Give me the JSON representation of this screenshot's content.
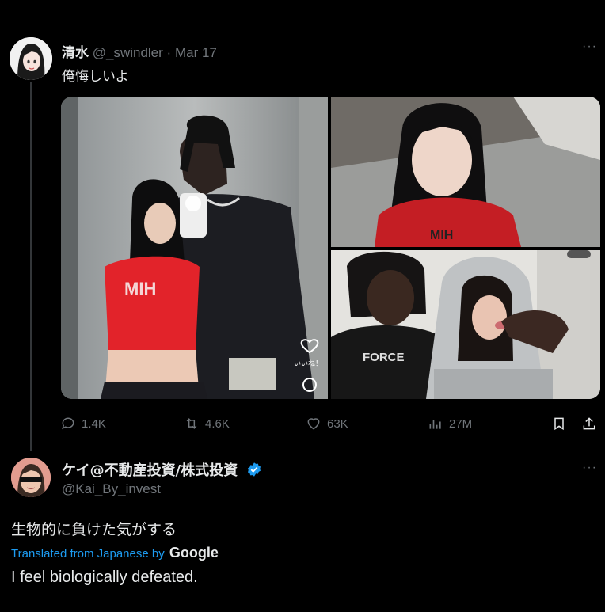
{
  "tweet": {
    "display_name": "清水",
    "handle": "@_swindler",
    "separator": "·",
    "date": "Mar 17",
    "more": "···",
    "text": "俺悔しいよ",
    "media": {
      "main_photo_caption": "いいね！"
    },
    "actions": {
      "replies": "1.4K",
      "retweets": "4.6K",
      "likes": "63K",
      "views": "27M"
    }
  },
  "reply": {
    "display_name": "ケイ@不動産投資/株式投資",
    "handle": "@Kai_By_invest",
    "more": "···",
    "text": "生物的に負けた気がする",
    "translated_label": "Translated from Japanese by",
    "translator": "Google",
    "translation": "I feel biologically defeated."
  },
  "colors": {
    "background": "#000000",
    "text": "#e7e9ea",
    "muted": "#71767b",
    "link": "#1d9bf0"
  },
  "icons": [
    "reply-icon",
    "retweet-icon",
    "like-icon",
    "views-icon",
    "bookmark-icon",
    "share-icon",
    "verified-icon"
  ]
}
